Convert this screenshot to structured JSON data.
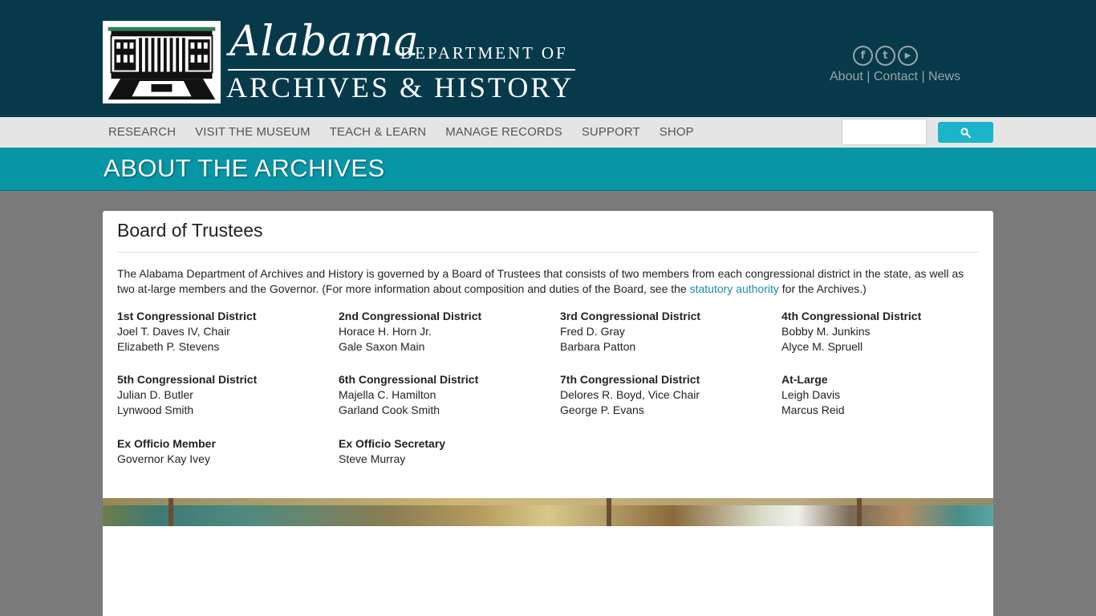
{
  "header": {
    "logo_script": "Alabama",
    "logo_dept": "DEPARTMENT OF",
    "logo_main": "ARCHIVES & HISTORY",
    "social": [
      {
        "icon": "facebook-icon",
        "glyph": "f"
      },
      {
        "icon": "twitter-icon",
        "glyph": "t"
      },
      {
        "icon": "youtube-icon",
        "glyph": "▶"
      }
    ],
    "util_links": [
      "About",
      "Contact",
      "News"
    ],
    "util_sep": " | "
  },
  "nav": {
    "items": [
      "RESEARCH",
      "VISIT THE MUSEUM",
      "TEACH & LEARN",
      "MANAGE RECORDS",
      "SUPPORT",
      "SHOP"
    ],
    "search_placeholder": "",
    "search_icon": "search-icon"
  },
  "banner": {
    "title": "ABOUT THE ARCHIVES"
  },
  "content": {
    "title": "Board of Trustees",
    "intro_before": "The Alabama Department of Archives and History is governed by a Board of Trustees that consists of two members from each congressional district in the state, as well as two at-large members and the Governor. (For more information about composition and duties of the Board, see the ",
    "intro_link": "statutory authority",
    "intro_after": " for the Archives.)",
    "districts": [
      {
        "name": "1st Congressional District",
        "members": [
          "Joel T. Daves IV, Chair",
          "Elizabeth P. Stevens"
        ]
      },
      {
        "name": "2nd Congressional District",
        "members": [
          "Horace H. Horn Jr.",
          "Gale Saxon Main"
        ]
      },
      {
        "name": "3rd Congressional District",
        "members": [
          "Fred D. Gray",
          "Barbara Patton"
        ]
      },
      {
        "name": "4th Congressional District",
        "members": [
          "Bobby M. Junkins",
          "Alyce M. Spruell"
        ]
      },
      {
        "name": "5th Congressional District",
        "members": [
          "Julian D. Butler",
          "Lynwood Smith"
        ]
      },
      {
        "name": "6th Congressional District",
        "members": [
          "Majella C. Hamilton",
          "Garland Cook Smith"
        ]
      },
      {
        "name": "7th Congressional District",
        "members": [
          "Delores R. Boyd, Vice Chair",
          "George P. Evans"
        ]
      },
      {
        "name": "At-Large",
        "members": [
          "Leigh Davis",
          "Marcus Reid"
        ]
      },
      {
        "name": "Ex Officio Member",
        "members": [
          "Governor Kay Ivey"
        ]
      },
      {
        "name": "Ex Officio Secretary",
        "members": [
          "Steve Murray"
        ]
      }
    ]
  },
  "colors": {
    "header_bg": "#063a4b",
    "nav_bg": "#e5e5e5",
    "banner_bg": "#0796a6",
    "accent": "#1ab5c8",
    "link": "#1a8fa1",
    "page_bg": "#7a7a7a"
  }
}
